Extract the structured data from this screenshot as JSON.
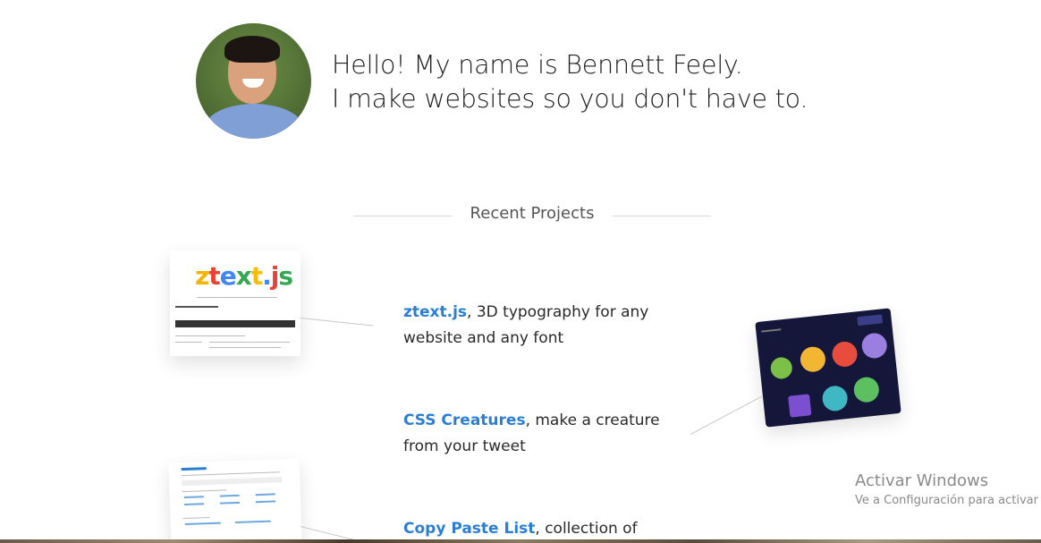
{
  "intro": {
    "line1": "Hello! My name is Bennett Feely.",
    "line2": "I make websites so you don't have to."
  },
  "section": {
    "title": "Recent Projects"
  },
  "projects": [
    {
      "name": "ztext.js",
      "description": ", 3D typography for any website and any font"
    },
    {
      "name": "CSS Creatures",
      "description": ", make a creature from your tweet"
    },
    {
      "name": "Copy Paste List",
      "description": ", collection of"
    }
  ],
  "thumbs": {
    "ztext_logo": "ztext.js",
    "ztext_logo_colors": [
      "#f4b400",
      "#ea4335",
      "#4285f4",
      "#34a853",
      "#fbbc05",
      "#4285f4",
      "#ea4335",
      "#34a853"
    ],
    "creatures_bg": "#14163a",
    "creature_colors": [
      "#7cc04a",
      "#f2b632",
      "#e84c3d",
      "#9b7fe0",
      "#7b4fd0",
      "#3fb8c4",
      "#5cc060"
    ]
  },
  "watermark": {
    "title": "Activar Windows",
    "subtitle": "Ve a Configuración para activar"
  },
  "colors": {
    "link": "#2a7fd4"
  }
}
